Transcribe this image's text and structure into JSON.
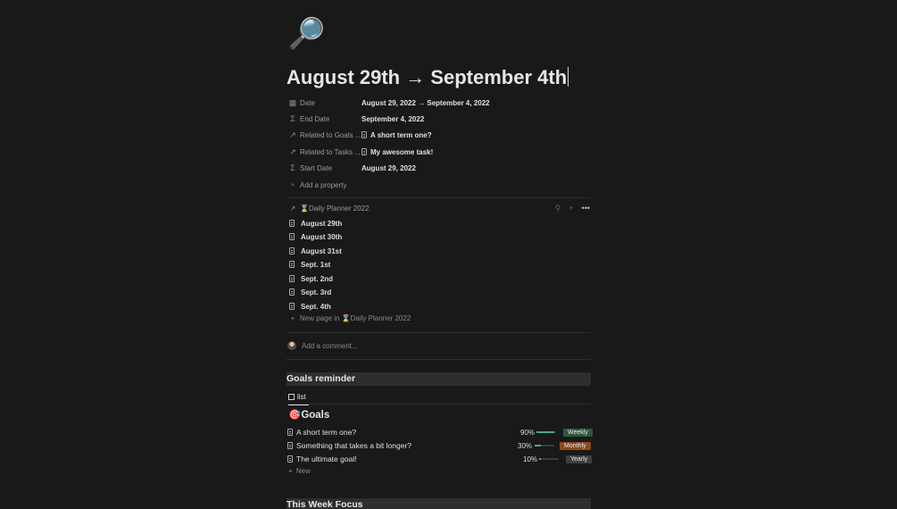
{
  "page": {
    "emoji": "🔎",
    "title": "August 29th → September 4th"
  },
  "properties": [
    {
      "icon": "calendar-icon",
      "glyph": "▦",
      "name": "Date",
      "value": "August 29, 2022 → September 4, 2022",
      "doc": false
    },
    {
      "icon": "formula-icon",
      "glyph": "Σ",
      "name": "End Date",
      "value": "September 4, 2022",
      "doc": false
    },
    {
      "icon": "relation-arrow-icon",
      "glyph": "↗",
      "name": "Related to Goals ...",
      "value": "A short term one?",
      "doc": true
    },
    {
      "icon": "relation-arrow-icon",
      "glyph": "↗",
      "name": "Related to Tasks ...",
      "value": "My awesome task!",
      "doc": true
    },
    {
      "icon": "formula-icon",
      "glyph": "Σ",
      "name": "Start Date",
      "value": "August 29, 2022",
      "doc": false
    }
  ],
  "add_property": "Add a property",
  "linked_db": {
    "title": "⌛Daily Planner 2022",
    "pages": [
      "August 29th",
      "August 30th",
      "August 31st",
      "Sept. 1st",
      "Sept. 2nd",
      "Sept. 3rd",
      "Sept. 4th"
    ],
    "new_page": "New page in ⌛Daily Planner 2022"
  },
  "comment_placeholder": "Add a comment...",
  "goals_section": {
    "heading": "Goals reminder",
    "view_tab": "list",
    "db_title": "🎯Goals",
    "rows": [
      {
        "name": "A short term one?",
        "progress": 0.9,
        "progress_label": "90%",
        "tag": "Weekly",
        "tag_color": "#2b5a3c"
      },
      {
        "name": "Something that takes a bit longer?",
        "progress": 0.3,
        "progress_label": "30%",
        "tag": "Monthly",
        "tag_color": "#8a4a1c"
      },
      {
        "name": "The ultimate goal!",
        "progress": 0.1,
        "progress_label": "10%",
        "tag": "Yearly",
        "tag_color": "#3f3f3f"
      }
    ],
    "new_label": "New"
  },
  "next_heading": "This Week Focus"
}
